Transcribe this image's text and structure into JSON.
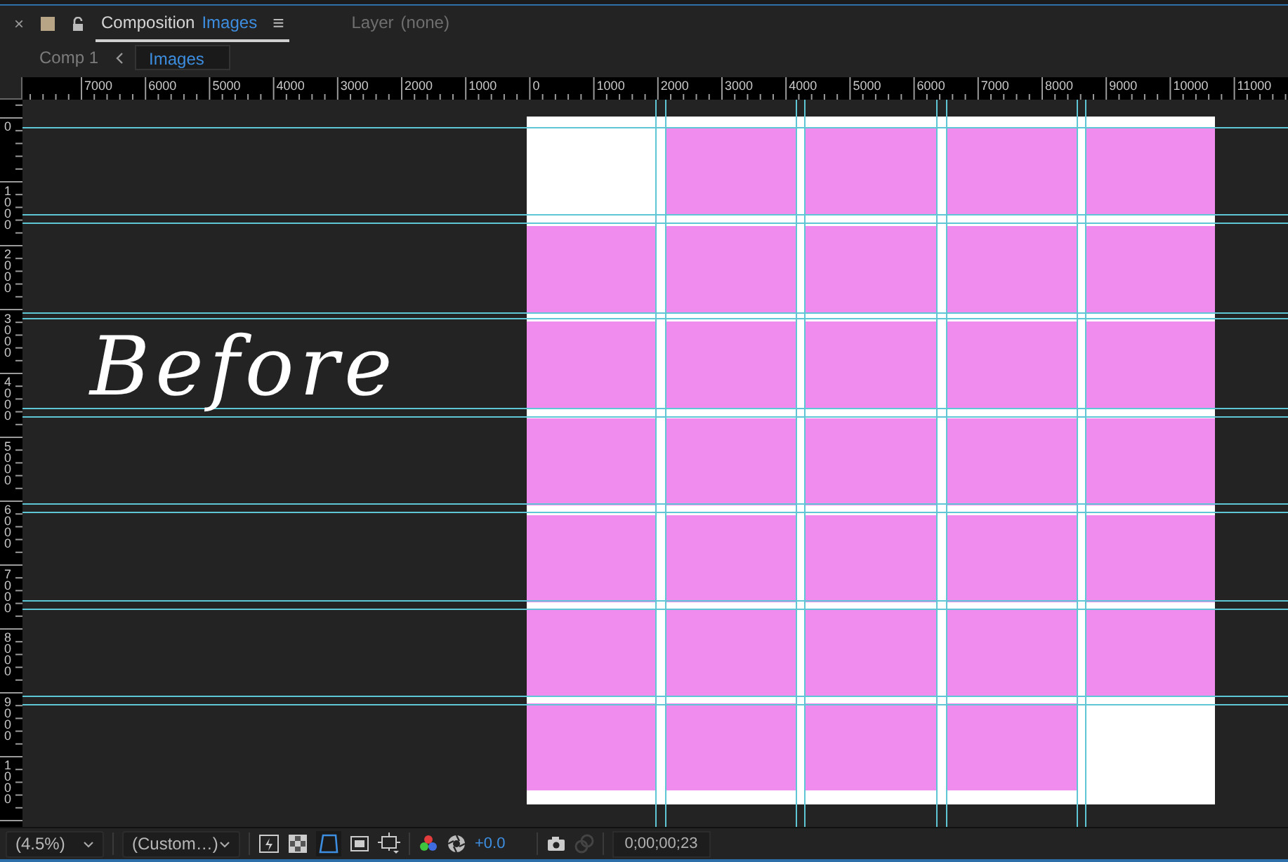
{
  "panel_tabs": [
    {
      "kind": "composition",
      "label": "Composition",
      "name": "Images",
      "selected": true
    },
    {
      "kind": "layer",
      "label": "Layer",
      "name": "(none)",
      "selected": false
    }
  ],
  "close_glyph": "×",
  "menu_glyph": "≡",
  "breadcrumb": [
    {
      "label": "Comp 1",
      "selected": false
    },
    {
      "label": "Images",
      "selected": true
    }
  ],
  "ruler_h": [
    "7000",
    "6000",
    "5000",
    "4000",
    "3000",
    "2000",
    "1000",
    "0",
    "1000",
    "2000",
    "3000",
    "4000",
    "5000",
    "6000",
    "7000",
    "8000",
    "9000",
    "10000",
    "11000"
  ],
  "ruler_v": [
    "0",
    "1000",
    "2000",
    "3000",
    "4000",
    "5000",
    "6000",
    "7000",
    "8000",
    "9000",
    "1000"
  ],
  "annotation": "Before",
  "grid": [
    [
      {
        "filled": false
      },
      {
        "filled": true
      },
      {
        "filled": true
      },
      {
        "filled": true
      },
      {
        "filled": true
      }
    ],
    [
      {
        "filled": true
      },
      {
        "filled": true
      },
      {
        "filled": true
      },
      {
        "filled": true
      },
      {
        "filled": true
      }
    ],
    [
      {
        "filled": true
      },
      {
        "filled": true
      },
      {
        "filled": true
      },
      {
        "filled": true
      },
      {
        "filled": true
      }
    ],
    [
      {
        "filled": true
      },
      {
        "filled": true
      },
      {
        "filled": true
      },
      {
        "filled": true
      },
      {
        "filled": true
      }
    ],
    [
      {
        "filled": true
      },
      {
        "filled": true
      },
      {
        "filled": true
      },
      {
        "filled": true
      },
      {
        "filled": true
      }
    ],
    [
      {
        "filled": true
      },
      {
        "filled": true
      },
      {
        "filled": true
      },
      {
        "filled": true
      },
      {
        "filled": true
      }
    ],
    [
      {
        "filled": true
      },
      {
        "filled": true
      },
      {
        "filled": true
      },
      {
        "filled": true
      },
      {
        "filled": false
      }
    ]
  ],
  "footer": {
    "zoom": "(4.5%)",
    "resolution": "(Custom…)",
    "exposure": "+0.0",
    "timecode": "0;00;00;23"
  }
}
